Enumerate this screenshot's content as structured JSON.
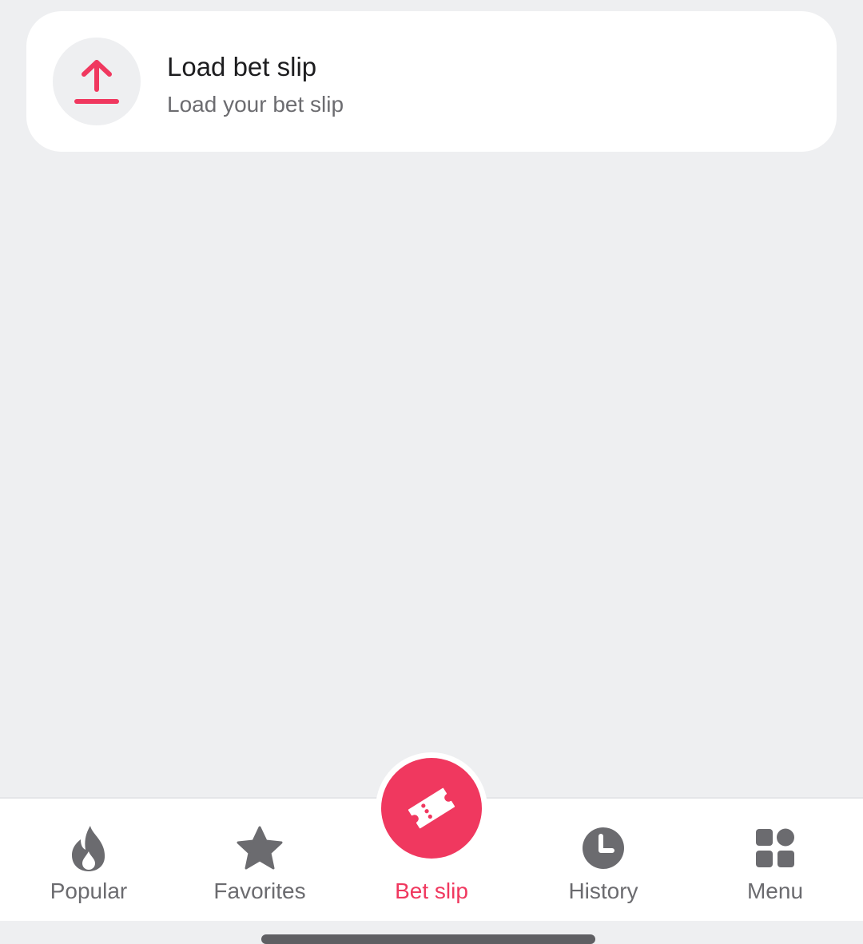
{
  "load_card": {
    "title": "Load bet slip",
    "subtitle": "Load your bet slip",
    "icon": "upload-icon"
  },
  "tabbar": {
    "tabs": [
      {
        "label": "Popular",
        "icon": "flame-icon",
        "active": false
      },
      {
        "label": "Favorites",
        "icon": "star-icon",
        "active": false
      },
      {
        "label": "Bet slip",
        "icon": "ticket-icon",
        "active": true
      },
      {
        "label": "History",
        "icon": "clock-icon",
        "active": false
      },
      {
        "label": "Menu",
        "icon": "grid-icon",
        "active": false
      }
    ]
  },
  "colors": {
    "accent": "#f0385f",
    "background": "#eeeff1",
    "card": "#ffffff",
    "inactive": "#6b6b6f"
  }
}
